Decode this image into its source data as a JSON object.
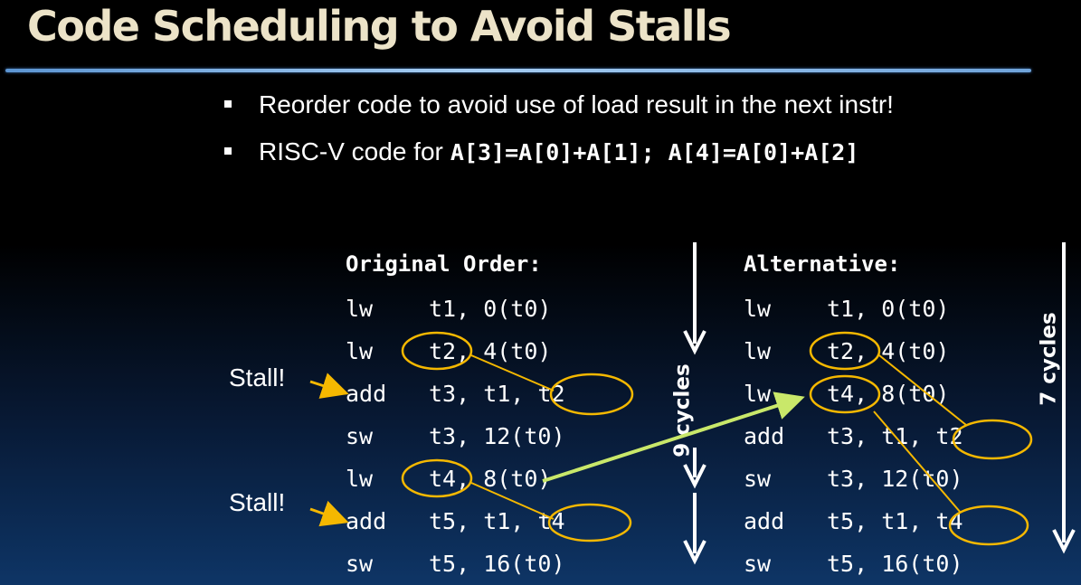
{
  "title": "Code Scheduling to Avoid Stalls",
  "bullets": [
    {
      "text": "Reorder code to avoid use of load result in the next instr!",
      "code": ""
    },
    {
      "text": "RISC-V code for",
      "code": "A[3]=A[0]+A[1]; A[4]=A[0]+A[2]"
    }
  ],
  "original": {
    "header": "Original Order:",
    "rows": [
      {
        "op": "lw",
        "args": "t1, 0(t0)"
      },
      {
        "op": "lw",
        "args": "t2, 4(t0)"
      },
      {
        "op": "add",
        "args": "t3, t1, t2"
      },
      {
        "op": "sw",
        "args": "t3, 12(t0)"
      },
      {
        "op": "lw",
        "args": "t4, 8(t0)"
      },
      {
        "op": "add",
        "args": "t5, t1, t4"
      },
      {
        "op": "sw",
        "args": "t5, 16(t0)"
      }
    ],
    "cycles_label": "9 cycles"
  },
  "alternative": {
    "header": "Alternative:",
    "rows": [
      {
        "op": "lw",
        "args": "t1, 0(t0)"
      },
      {
        "op": "lw",
        "args": "t2, 4(t0)"
      },
      {
        "op": "lw",
        "args": "t4, 8(t0)"
      },
      {
        "op": "add",
        "args": "t3, t1, t2"
      },
      {
        "op": "sw",
        "args": "t3, 12(t0)"
      },
      {
        "op": "add",
        "args": "t5, t1, t4"
      },
      {
        "op": "sw",
        "args": "t5, 16(t0)"
      }
    ],
    "cycles_label": "7 cycles"
  },
  "stall_labels": [
    "Stall!",
    "Stall!"
  ],
  "colors": {
    "title": "#ece3c8",
    "highlight_oval": "#f5b800",
    "move_arrow": "#c9e86a",
    "text": "#ffffff"
  }
}
